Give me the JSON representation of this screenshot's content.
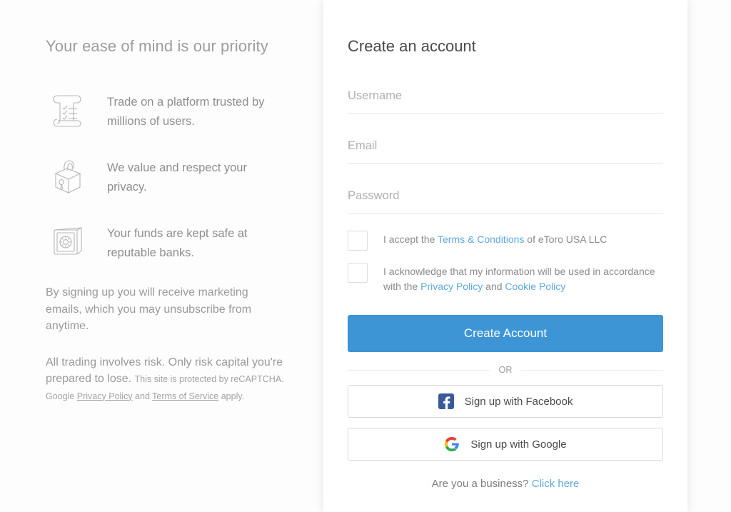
{
  "left": {
    "heading": "Your ease of mind is our priority",
    "features": [
      {
        "icon": "scroll-checklist-icon",
        "text": "Trade on a platform trusted by millions of users."
      },
      {
        "icon": "padlock-icon",
        "text": "We value and respect your privacy."
      },
      {
        "icon": "safe-vault-icon",
        "text": "Your funds are kept safe at reputable banks."
      }
    ],
    "marketing_note": "By signing up you will receive marketing emails, which you may unsubscribe from anytime.",
    "risk_note": "All trading involves risk. Only risk capital you're prepared to lose.",
    "recaptcha": {
      "before": "This site is protected by reCAPTCHA. Google ",
      "privacy_policy": "Privacy Policy",
      "and": " and ",
      "terms_of_service": "Terms of Service",
      "after": " apply."
    }
  },
  "card": {
    "title": "Create an account",
    "fields": {
      "username": {
        "placeholder": "Username",
        "value": ""
      },
      "email": {
        "placeholder": "Email",
        "value": ""
      },
      "password": {
        "placeholder": "Password",
        "value": ""
      }
    },
    "consent": {
      "terms": {
        "before": "I accept the ",
        "link": "Terms & Conditions",
        "after": " of eToro USA LLC",
        "checked": false
      },
      "privacy": {
        "before": "I acknowledge that my information will be used in accordance with the ",
        "link1": "Privacy Policy",
        "middle": " and ",
        "link2": "Cookie Policy",
        "checked": false
      }
    },
    "create_account_label": "Create Account",
    "or_label": "OR",
    "facebook_label": "Sign up with Facebook",
    "google_label": "Sign up with Google",
    "business": {
      "question": "Are you a business? ",
      "link": "Click here"
    }
  },
  "colors": {
    "primary_button": "#3d95d5",
    "link": "#5fa8dc",
    "facebook_blue": "#3b5998",
    "google_blue": "#4285F4",
    "google_red": "#EA4335",
    "google_yellow": "#FBBC05",
    "google_green": "#34A853"
  }
}
